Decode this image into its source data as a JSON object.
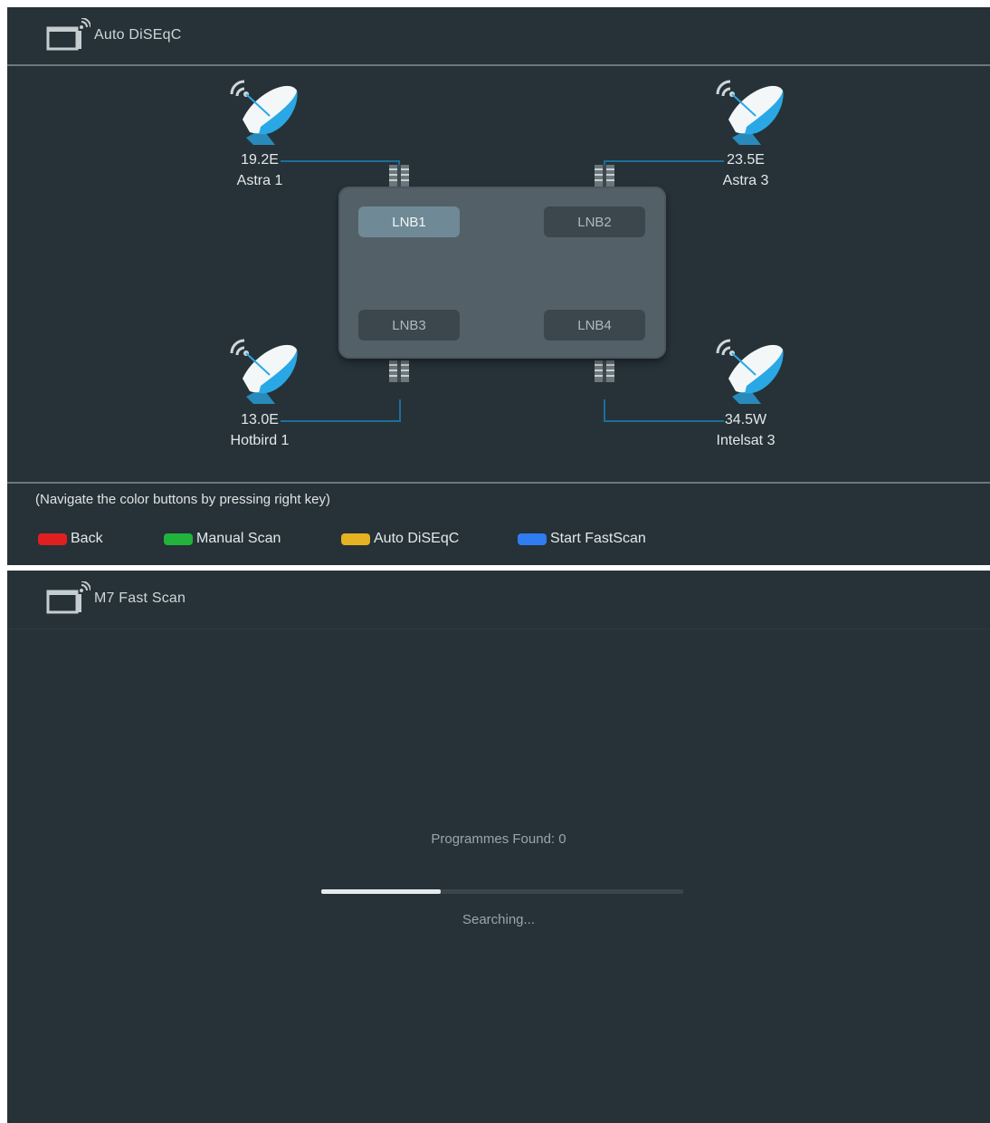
{
  "screen1": {
    "title": "Auto DiSEqC",
    "satellites": [
      {
        "position": "19.2E",
        "name": "Astra 1"
      },
      {
        "position": "23.5E",
        "name": "Astra 3"
      },
      {
        "position": "13.0E",
        "name": "Hotbird 1"
      },
      {
        "position": "34.5W",
        "name": "Intelsat 3"
      }
    ],
    "lnbs": [
      "LNB1",
      "LNB2",
      "LNB3",
      "LNB4"
    ],
    "selected_lnb": "LNB1",
    "hint": "(Navigate the color buttons by pressing right key)",
    "buttons": [
      {
        "label": "Back",
        "color": "#e02020"
      },
      {
        "label": "Manual Scan",
        "color": "#22b33c"
      },
      {
        "label": "Auto DiSEqC",
        "color": "#e5b321"
      },
      {
        "label": "Start FastScan",
        "color": "#2f7df0"
      }
    ]
  },
  "screen2": {
    "title": "M7 Fast Scan",
    "programmes_found": "Programmes Found: 0",
    "progress_fraction": 0.33,
    "status": "Searching..."
  },
  "icons": {
    "header": "tv-wifi-icon",
    "satellite": "satellite-dish-icon",
    "connector": "lnb-connector-icon"
  },
  "colors": {
    "background": "#263238",
    "dish": "#2aa8e6",
    "cable": "#1b6f9a"
  }
}
